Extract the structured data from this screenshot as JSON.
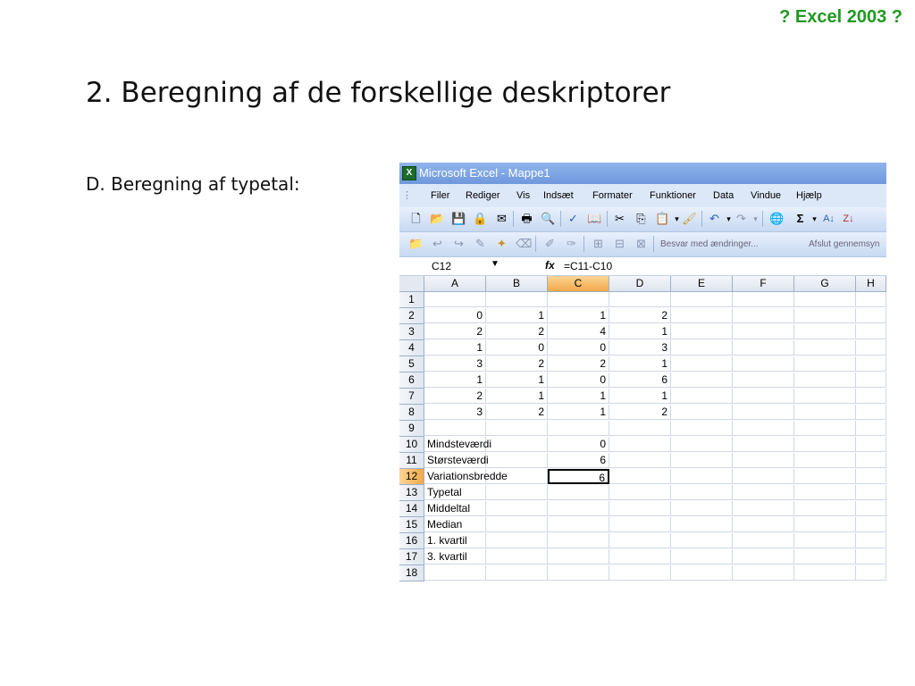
{
  "top_tag": "? Excel 2003 ?",
  "slide_title": "2. Beregning af de forskellige deskriptorer",
  "subtitle": "D. Beregning af typetal:",
  "window_title": "Microsoft Excel - Mappe1",
  "menu": [
    "Filer",
    "Rediger",
    "Vis",
    "Indsæt",
    "Formater",
    "Funktioner",
    "Data",
    "Vindue",
    "Hjælp"
  ],
  "toolbar2_text": [
    "Besvar med ændringer...",
    "Afslut gennemsyn"
  ],
  "name_box": "C12",
  "formula": "=C11-C10",
  "columns": [
    "A",
    "B",
    "C",
    "D",
    "E",
    "F",
    "G",
    "H"
  ],
  "selected_column": "C",
  "selected_row": "12",
  "rows": [
    {
      "num": "1",
      "cells": [
        "",
        "",
        "",
        ""
      ]
    },
    {
      "num": "2",
      "cells": [
        "0",
        "1",
        "1",
        "2"
      ]
    },
    {
      "num": "3",
      "cells": [
        "2",
        "2",
        "4",
        "1"
      ]
    },
    {
      "num": "4",
      "cells": [
        "1",
        "0",
        "0",
        "3"
      ]
    },
    {
      "num": "5",
      "cells": [
        "3",
        "2",
        "2",
        "1"
      ]
    },
    {
      "num": "6",
      "cells": [
        "1",
        "1",
        "0",
        "6"
      ]
    },
    {
      "num": "7",
      "cells": [
        "2",
        "1",
        "1",
        "1"
      ]
    },
    {
      "num": "8",
      "cells": [
        "3",
        "2",
        "1",
        "2"
      ]
    },
    {
      "num": "9",
      "cells": [
        "",
        "",
        "",
        ""
      ]
    },
    {
      "num": "10",
      "label": "Mindsteværdi",
      "c": "0"
    },
    {
      "num": "11",
      "label": "Størsteværdi",
      "c": "6"
    },
    {
      "num": "12",
      "label": "Variationsbredde",
      "c": "6"
    },
    {
      "num": "13",
      "label": "Typetal",
      "c": ""
    },
    {
      "num": "14",
      "label": "Middeltal",
      "c": ""
    },
    {
      "num": "15",
      "label": "Median",
      "c": ""
    },
    {
      "num": "16",
      "label": "1. kvartil",
      "c": ""
    },
    {
      "num": "17",
      "label": "3. kvartil",
      "c": ""
    },
    {
      "num": "18",
      "label": "",
      "c": ""
    }
  ]
}
